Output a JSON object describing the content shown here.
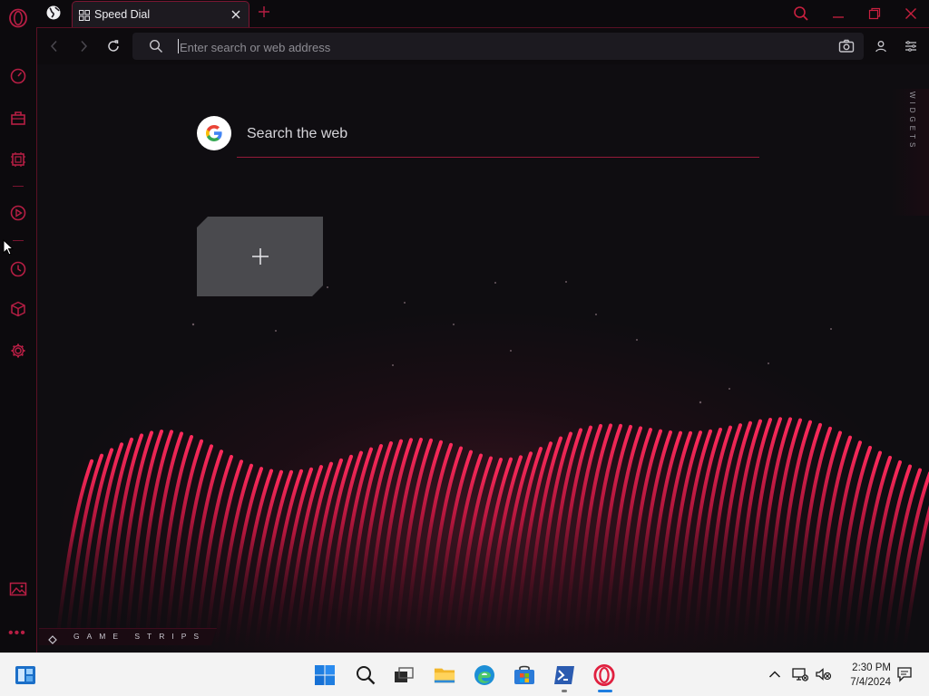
{
  "browser": {
    "name": "Opera GX",
    "accent_color": "#b71e44"
  },
  "tabs": [
    {
      "title": "Speed Dial",
      "active": true
    }
  ],
  "addressbar": {
    "placeholder": "Enter search or web address",
    "value": ""
  },
  "sidebar": {
    "items": [
      {
        "name": "opera-logo-icon"
      },
      {
        "name": "gx-control-icon"
      },
      {
        "name": "gx-corner-icon"
      },
      {
        "name": "hot-tabs-killer-icon"
      },
      {
        "name": "player-icon"
      },
      {
        "name": "history-icon"
      },
      {
        "name": "extensions-cube-icon"
      },
      {
        "name": "settings-icon"
      },
      {
        "name": "wallpaper-icon"
      },
      {
        "name": "more-icon"
      }
    ]
  },
  "speed_dial": {
    "search_placeholder": "Search the web",
    "search_engine": "Google",
    "add_tile_icon": "plus-icon",
    "widgets_label": "WIDGETS",
    "gamestrips_label": "GAME STRIPS"
  },
  "taskbar": {
    "items": [
      {
        "name": "widgets-icon"
      },
      {
        "name": "start-icon"
      },
      {
        "name": "search-icon"
      },
      {
        "name": "task-view-icon"
      },
      {
        "name": "file-explorer-icon"
      },
      {
        "name": "edge-icon"
      },
      {
        "name": "store-icon"
      },
      {
        "name": "powershell-icon"
      },
      {
        "name": "opera-icon",
        "active": true
      }
    ],
    "tray": {
      "time": "2:30 PM",
      "date": "7/4/2024"
    }
  }
}
